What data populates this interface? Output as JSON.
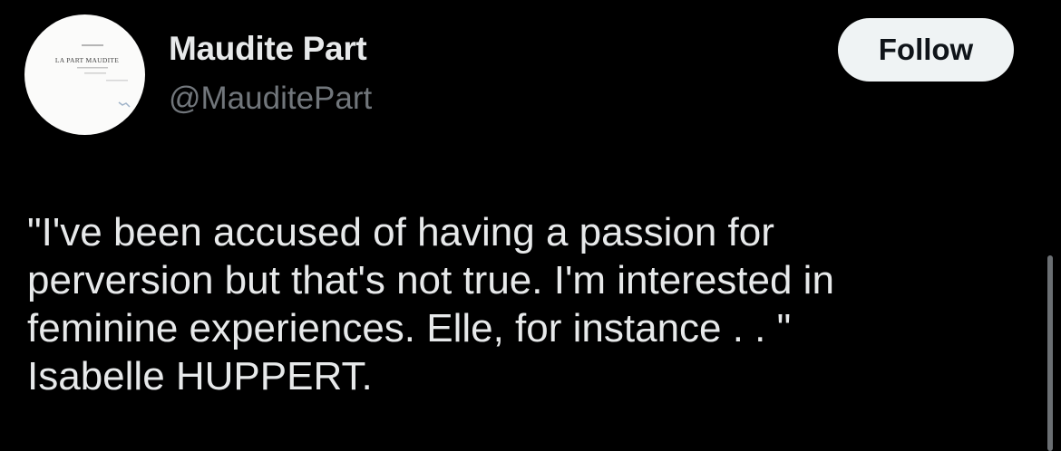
{
  "profile": {
    "display_name": "Maudite Part",
    "handle": "@MauditePart",
    "avatar_title": "LA PART MAUDITE"
  },
  "actions": {
    "follow_label": "Follow"
  },
  "tweet": {
    "text": "\"I've been accused of having a passion for\nperversion but that's not true. I'm interested in\nfeminine experiences. Elle, for instance . . \"\nIsabelle HUPPERT."
  },
  "colors": {
    "background": "#000000",
    "primary_text": "#e7e9ea",
    "secondary_text": "#71767b",
    "button_bg": "#eff3f4",
    "button_text": "#0f1419"
  }
}
